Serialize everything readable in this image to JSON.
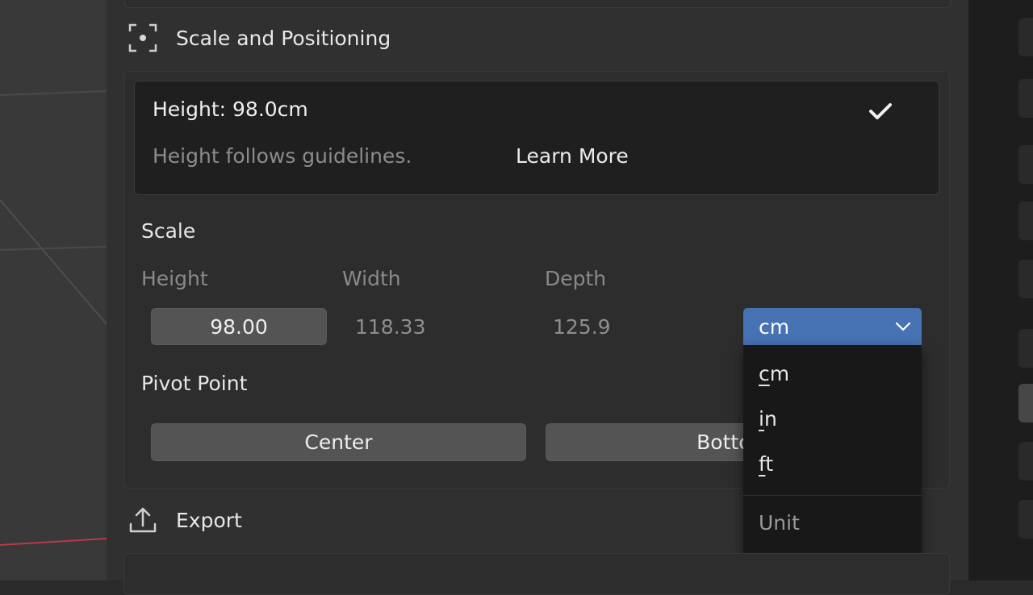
{
  "scale_section": {
    "title": "Scale and Positioning",
    "icon": "frame-focus-icon"
  },
  "height_card": {
    "title": "Height: 98.0cm",
    "status_icon": "checkmark-icon",
    "note": "Height follows guidelines.",
    "link": "Learn More"
  },
  "scale": {
    "heading": "Scale",
    "labels": {
      "height": "Height",
      "width": "Width",
      "depth": "Depth"
    },
    "values": {
      "height": "98.00",
      "width": "118.33",
      "depth": "125.9"
    },
    "unit": {
      "selected": "cm"
    }
  },
  "pivot": {
    "heading": "Pivot Point",
    "center": "Center",
    "bottom": "Bottom"
  },
  "unit_dropdown": {
    "options": [
      {
        "hotkey": "c",
        "rest": "m"
      },
      {
        "hotkey": "i",
        "rest": "n"
      },
      {
        "hotkey": "f",
        "rest": "t"
      }
    ],
    "header": "Unit"
  },
  "export_section": {
    "title": "Export",
    "icon": "upload-icon"
  },
  "colors": {
    "accent": "#4772b3",
    "panel": "#303030",
    "card": "#1f1f1f",
    "button": "#545454"
  }
}
